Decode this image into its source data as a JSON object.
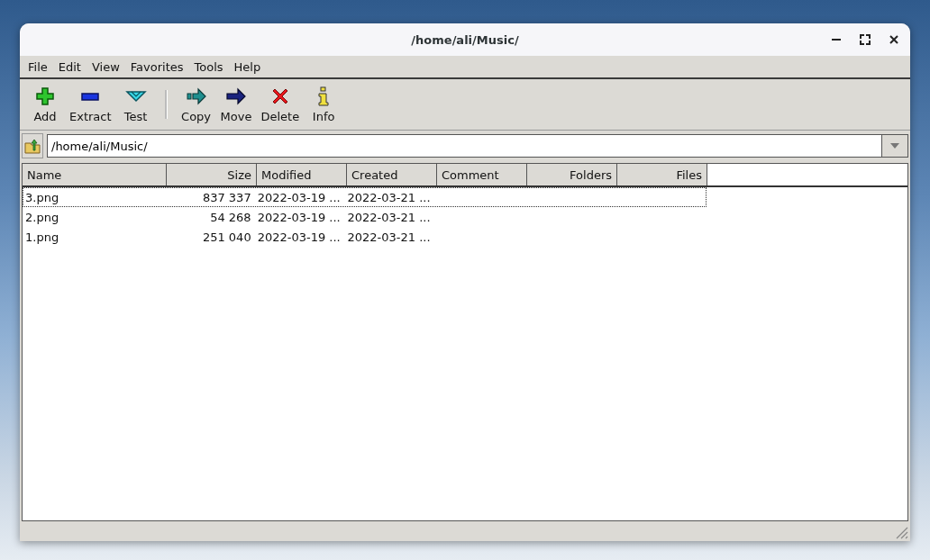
{
  "window": {
    "title": "/home/ali/Music/"
  },
  "menu": [
    "File",
    "Edit",
    "View",
    "Favorites",
    "Tools",
    "Help"
  ],
  "toolbar": {
    "groups": [
      [
        {
          "kind": "add",
          "label": "Add"
        },
        {
          "kind": "extract",
          "label": "Extract"
        },
        {
          "kind": "test",
          "label": "Test"
        }
      ],
      [
        {
          "kind": "copy",
          "label": "Copy"
        },
        {
          "kind": "move",
          "label": "Move"
        },
        {
          "kind": "delete",
          "label": "Delete"
        },
        {
          "kind": "info",
          "label": "Info"
        }
      ]
    ]
  },
  "address": {
    "value": "/home/ali/Music/"
  },
  "table": {
    "columns": [
      "Name",
      "Size",
      "Modified",
      "Created",
      "Comment",
      "Folders",
      "Files"
    ],
    "rows": [
      {
        "focused": true,
        "cells": [
          "3.png",
          "837 337",
          "2022-03-19 ...",
          "2022-03-21 ..."
        ]
      },
      {
        "focused": false,
        "cells": [
          "2.png",
          "54 268",
          "2022-03-19 ...",
          "2022-03-21 ..."
        ]
      },
      {
        "focused": false,
        "cells": [
          "1.png",
          "251 040",
          "2022-03-19 ...",
          "2022-03-21 ..."
        ]
      }
    ]
  }
}
